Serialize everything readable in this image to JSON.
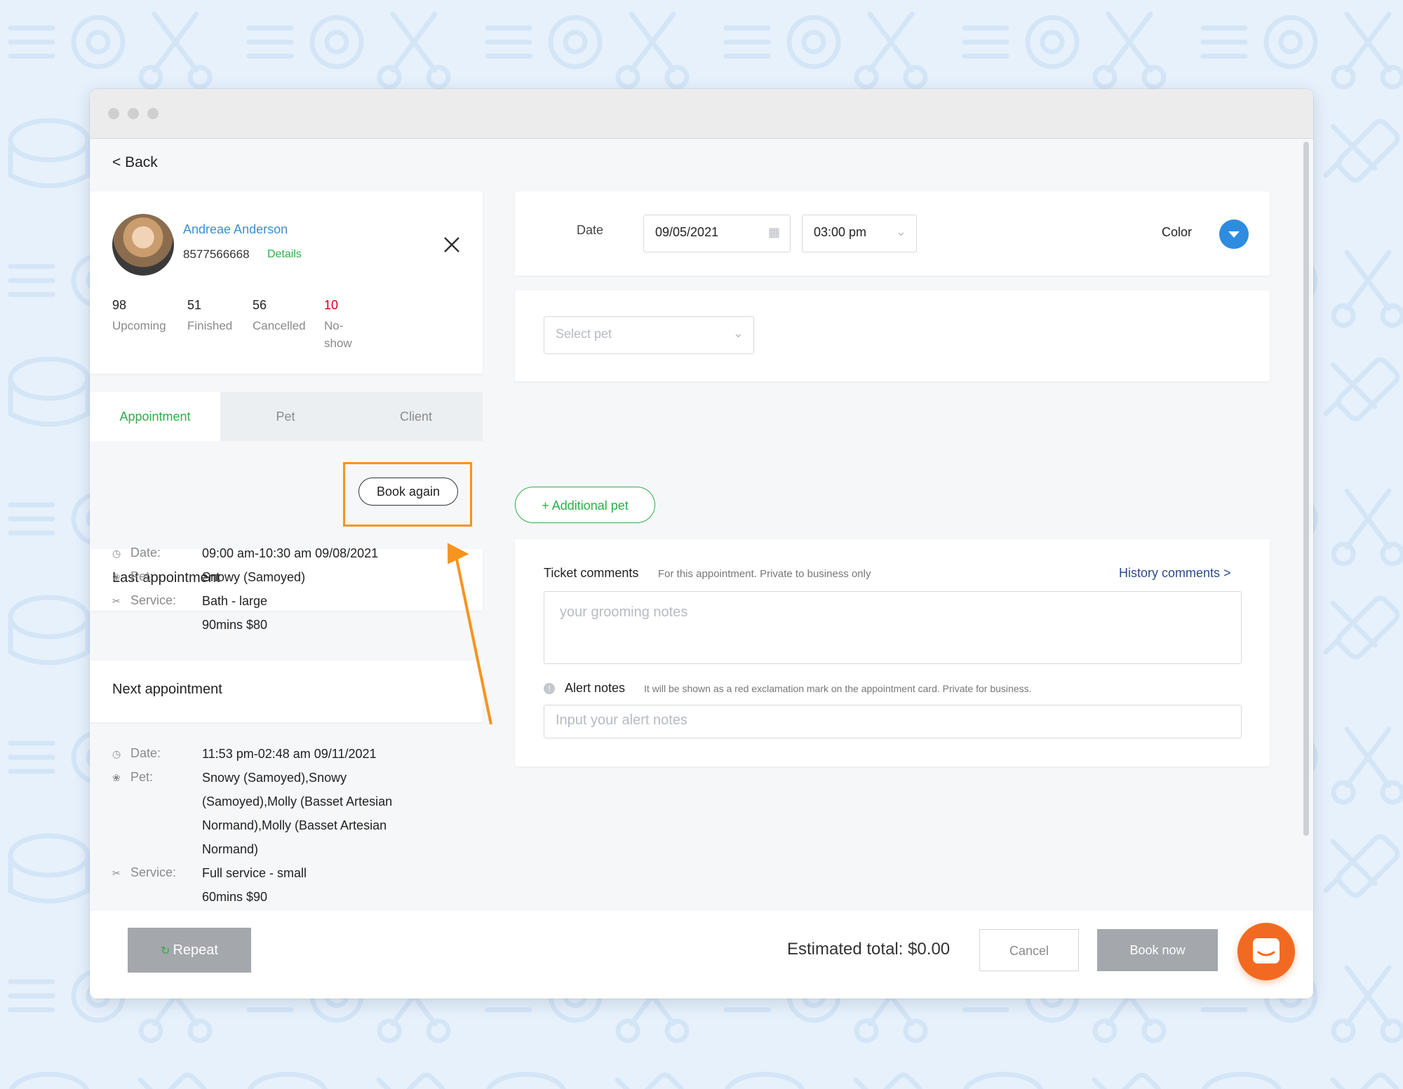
{
  "nav": {
    "back_label": "< Back"
  },
  "client": {
    "name": "Andreae Anderson",
    "phone": "8577566668",
    "details_label": "Details",
    "stats": [
      {
        "value": "98",
        "label": "Upcoming"
      },
      {
        "value": "51",
        "label": "Finished"
      },
      {
        "value": "56",
        "label": "Cancelled"
      },
      {
        "value": "10",
        "label": "No-show",
        "color": "#d0021b"
      }
    ]
  },
  "tabs": [
    {
      "label": "Appointment",
      "active": true
    },
    {
      "label": "Pet"
    },
    {
      "label": "Client"
    }
  ],
  "last_appointment": {
    "title": "Last appointment",
    "book_again_label": "Book again",
    "date_key": "Date:",
    "date": "09:00 am-10:30 am 09/08/2021",
    "pet_key": "Pet:",
    "pet": "Snowy (Samoyed)",
    "service_key": "Service:",
    "service": "Bath - large",
    "duration_price": "90mins  $80"
  },
  "next_appointment": {
    "title": "Next appointment",
    "date_key": "Date:",
    "date": "11:53 pm-02:48 am 09/11/2021",
    "pet_key": "Pet:",
    "pet_lines": [
      "Snowy (Samoyed),Snowy",
      "(Samoyed),Molly (Basset Artesian",
      "Normand),Molly (Basset Artesian",
      "Normand)"
    ],
    "service_key": "Service:",
    "service": "Full service - small",
    "duration_price": "60mins  $90"
  },
  "booking": {
    "date_label": "Date",
    "date_value": "09/05/2021",
    "time_value": "03:00 pm",
    "color_label": "Color",
    "color_value": "#2d8ce0",
    "select_pet_placeholder": "Select pet",
    "additional_pet_label": "+ Additional pet",
    "ticket_comments_label": "Ticket comments",
    "ticket_comments_note": "For this appointment. Private to business only",
    "history_comments_label": "History comments >",
    "grooming_placeholder": "your grooming notes",
    "alert_notes_label": "Alert notes",
    "alert_notes_note": "It will be shown as a red exclamation mark on the appointment card. Private for business.",
    "alert_placeholder": "Input your alert notes"
  },
  "footer": {
    "repeat_label": "Repeat",
    "estimated_total": "Estimated total: $0.00",
    "cancel_label": "Cancel",
    "book_now_label": "Book now"
  },
  "colors": {
    "accent_green": "#2fae4a",
    "link_blue": "#3b8fd8",
    "highlight_orange": "#f7941d",
    "chat_orange": "#f26a21"
  }
}
